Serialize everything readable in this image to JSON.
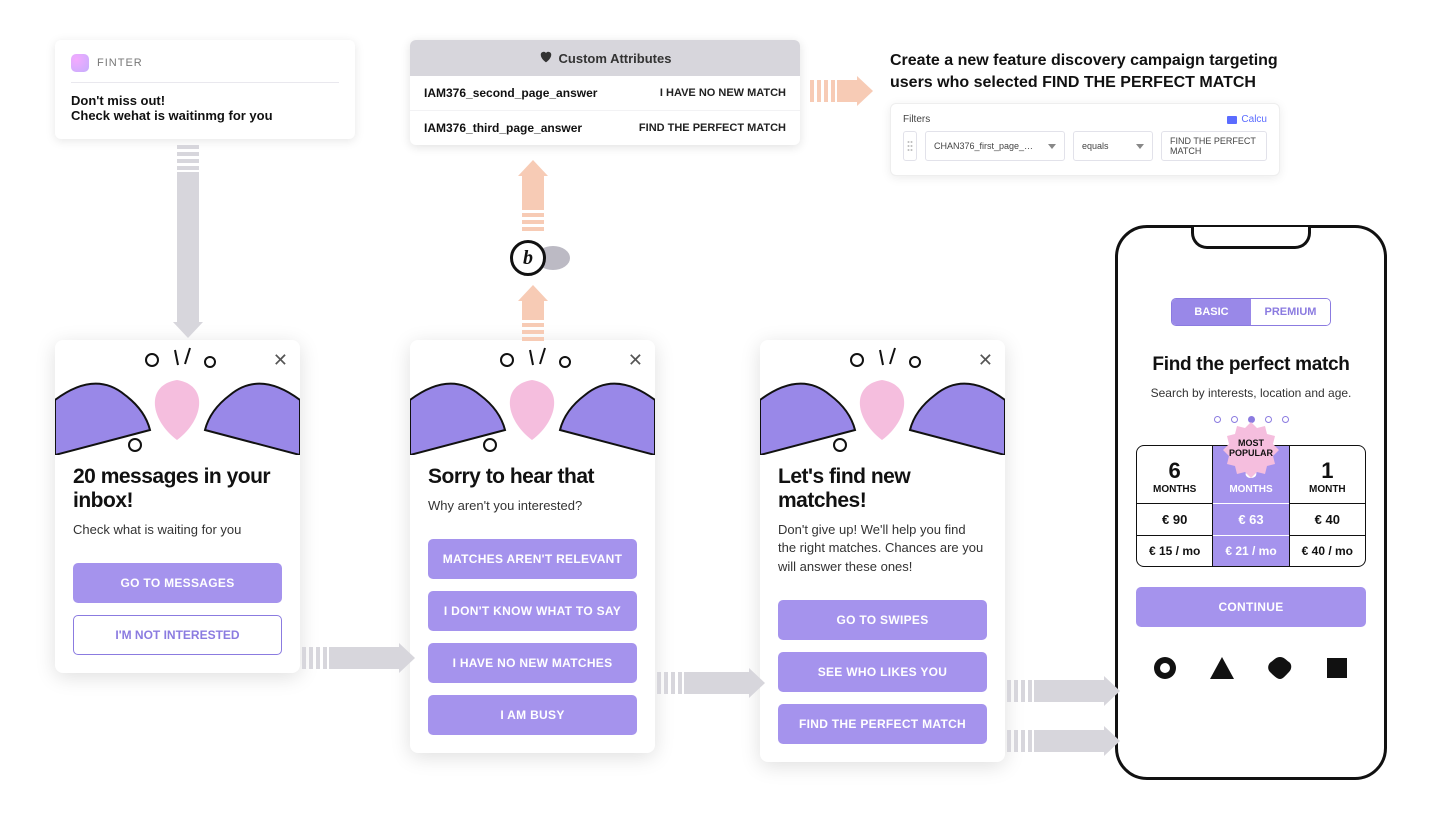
{
  "notification": {
    "app_name": "FINTER",
    "title": "Don't miss out!",
    "subtitle": "Check wehat is waitinmg for you"
  },
  "custom_attributes": {
    "panel_title": "Custom Attributes",
    "rows": [
      {
        "key": "IAM376_second_page_answer",
        "value": "I HAVE NO NEW MATCH"
      },
      {
        "key": "IAM376_third_page_answer",
        "value": "FIND THE PERFECT MATCH"
      }
    ]
  },
  "campaign": {
    "heading": "Create a new feature discovery campaign targeting users who selected FIND THE PERFECT MATCH",
    "filters_label": "Filters",
    "calc_label": "Calcu",
    "attribute": "CHAN376_first_page_…",
    "operator": "equals",
    "value": "FIND THE PERFECT MATCH"
  },
  "modals": {
    "card1": {
      "title": "20 messages in your inbox!",
      "subtitle": "Check what is waiting for you",
      "primary": "GO TO MESSAGES",
      "secondary": "I'M NOT INTERESTED"
    },
    "card2": {
      "title": "Sorry to hear that",
      "subtitle": "Why aren't you interested?",
      "options": [
        "MATCHES AREN'T RELEVANT",
        "I DON'T KNOW WHAT TO SAY",
        "I HAVE NO NEW MATCHES",
        "I AM BUSY"
      ]
    },
    "card3": {
      "title": "Let's find new matches!",
      "subtitle": "Don't give up! We'll help you find the right matches. Chances are you will answer these ones!",
      "options": [
        "GO TO SWIPES",
        "SEE WHO LIKES YOU",
        "FIND THE PERFECT MATCH"
      ]
    }
  },
  "phone": {
    "tabs": {
      "basic": "BASIC",
      "premium": "PREMIUM"
    },
    "title": "Find the perfect match",
    "subtitle": "Search by interests, location and age.",
    "badge": "MOST POPULAR",
    "plans": [
      {
        "num": "6",
        "unit": "MONTHS",
        "price": "€ 90",
        "per": "€ 15 / mo"
      },
      {
        "num": "3",
        "unit": "MONTHS",
        "price": "€ 63",
        "per": "€ 21 / mo"
      },
      {
        "num": "1",
        "unit": "MONTH",
        "price": "€ 40",
        "per": "€ 40 / mo"
      }
    ],
    "cta": "CONTINUE"
  },
  "logo_letter": "b"
}
